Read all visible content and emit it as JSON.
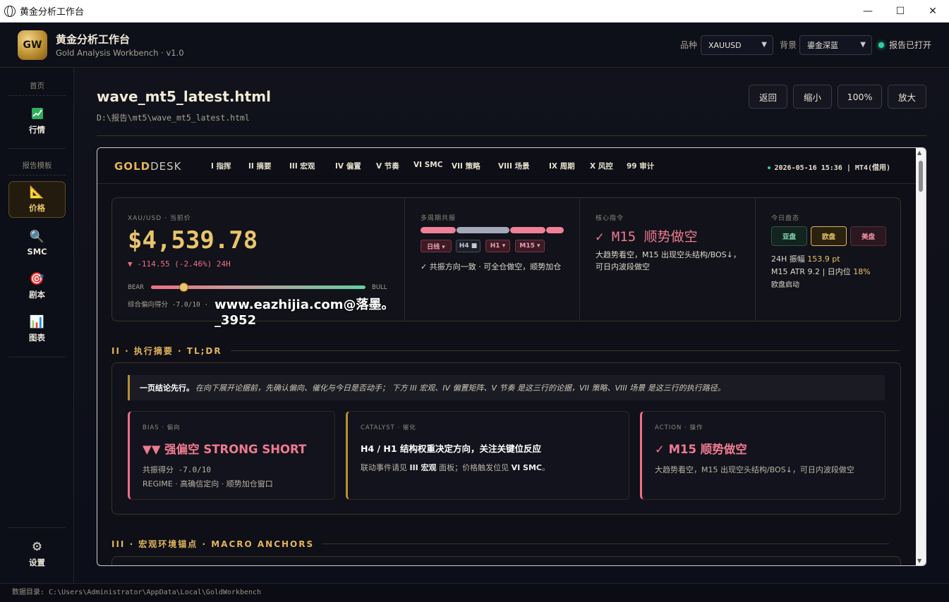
{
  "window": {
    "title": "黄金分析工作台",
    "min": "—",
    "max": "☐",
    "close": "✕"
  },
  "app": {
    "logo": "GW",
    "title": "黄金分析工作台",
    "subtitle": "Gold Analysis Workbench · v1.0"
  },
  "header": {
    "symbol_label": "品种",
    "symbol_value": "XAUUSD",
    "bg_label": "背景",
    "bg_value": "鎏金深蓝",
    "status": "报告已打开",
    "status_color": "#2ed0a0"
  },
  "sidebar": {
    "home_section": "首页",
    "market": {
      "label": "行情",
      "icon": "chart-up-icon"
    },
    "template_section": "报告模板",
    "items": [
      {
        "label": "价格",
        "icon": "ruler-triangle-icon",
        "glyph": "📐"
      },
      {
        "label": "SMC",
        "icon": "magnifier-icon",
        "glyph": "🔍"
      },
      {
        "label": "剧本",
        "icon": "target-icon",
        "glyph": "🎯"
      },
      {
        "label": "图表",
        "icon": "bar-chart-icon",
        "glyph": "📊"
      }
    ],
    "settings": "设置"
  },
  "main": {
    "doc_title": "wave_mt5_latest.html",
    "doc_path": "D:\\报告\\mt5\\wave_mt5_latest.html",
    "buttons": {
      "back": "返回",
      "zoom_out": "缩小",
      "zoom": "100%",
      "zoom_in": "放大"
    }
  },
  "report": {
    "brand_gold": "GOLD",
    "brand_desk": "DESK",
    "nav": [
      "I 指挥",
      "II 摘要",
      "III 宏观",
      "IV 偏置",
      "V 节奏",
      "VI SMC",
      "VII 策略",
      "VIII 场景",
      "IX 周期",
      "X 风控",
      "99 审计"
    ],
    "status": "2026-05-16 15:36 | MT4(借用)",
    "kpi": {
      "price_label": "XAU/USD · 当前价",
      "price": "$4,539.78",
      "change": "▼ -114.55 (-2.46%) 24H",
      "bear": "BEAR",
      "bull": "BULL",
      "bias_position": 0.15,
      "score": "综合偏向得分 -7.0/10 ·",
      "watermark": "www.eazhijia.com@落墨。_3952",
      "tf_label": "多周期共振",
      "tf_chips": [
        "日线 ▾",
        "H4 ■",
        "H1 ▾",
        "M15 ▾"
      ],
      "tf_note": "✓ 共振方向一致 · 可全仓做空，顺势加仓",
      "core_label": "核心指令",
      "core_title": "✓ M15 顺势做空",
      "core_desc": "大趋势看空，M15 出现空头结构/BOS↓，可日内波段做空",
      "today_label": "今日盘态",
      "sessions": [
        "亚盘",
        "欧盘",
        "美盘"
      ],
      "amp_label": "24H 振幅",
      "amp_value": "153.9 pt",
      "atr_label": "M15 ATR 9.2 | 日内位",
      "atr_value": "18%",
      "session_note": "欧盘启动"
    },
    "sec2": "II · 执行摘要 · TL;DR",
    "quote_bold": "一页结论先行。",
    "quote_text": "在向下展开论据前，先确认偏向、催化与今日是否动手； 下方 III 宏观、IV 偏置矩阵、V 节奏 是这三行的论据，VII 策略、VIII 场景 是这三行的执行路径。",
    "cards": [
      {
        "label": "BIAS · 偏向",
        "title": "▼▼ 强偏空 STRONG SHORT",
        "l1": "共振得分 -7.0/10",
        "l2": "REGIME · 高确信定向 · 顺势加仓窗口"
      },
      {
        "label": "CATALYST · 催化",
        "title": "H4 / H1 结构权重决定方向，关注关键位反应",
        "l1a": "联动事件请见 ",
        "l1b": "III 宏观",
        "l1c": " 面板；价格触发位见 ",
        "l1d": "VI SMC",
        "l1e": "。"
      },
      {
        "label": "ACTION · 操作",
        "title": "✓ M15 顺势做空",
        "l1": "大趋势看空，M15 出现空头结构/BOS↓，可日内波段做空"
      }
    ],
    "sec3": "III · 宏观环境锚点 · MACRO ANCHORS"
  },
  "footer": "数据目录: C:\\Users\\Administrator\\AppData\\Local\\GoldWorkbench",
  "colors": {
    "gold": "#e9c46a",
    "short": "#ef6f86",
    "long": "#5fd0a0"
  }
}
